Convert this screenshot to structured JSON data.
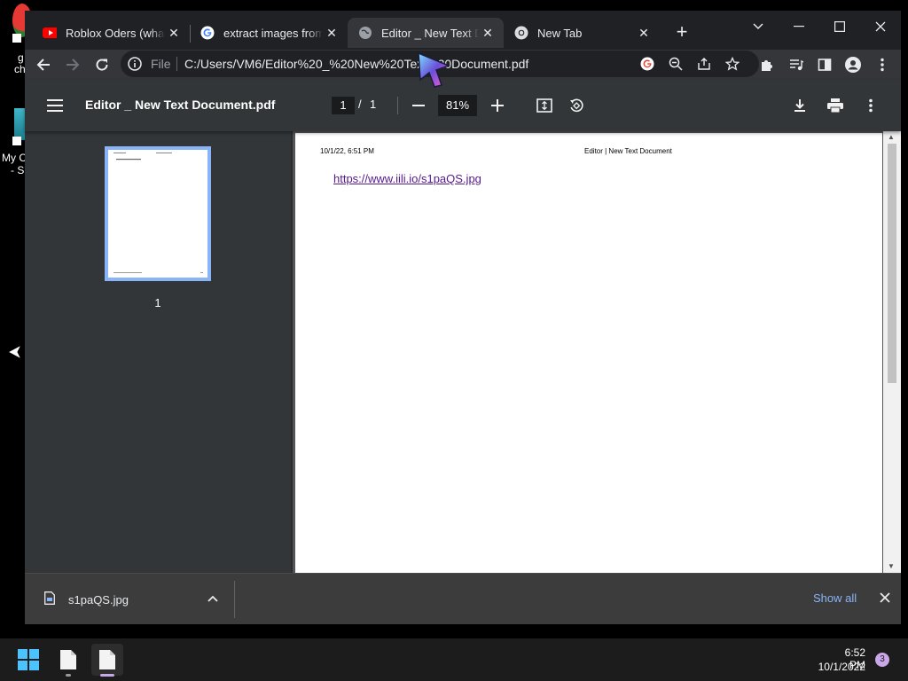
{
  "desktop": {
    "icon1_label_lines": [
      "g",
      "ch"
    ],
    "icon2_label_lines": [
      "My C",
      "- Sl"
    ]
  },
  "tabs": [
    {
      "title": "Roblox Oders (what h",
      "favicon": "youtube-icon",
      "active": false
    },
    {
      "title": "extract images from u",
      "favicon": "google-icon",
      "active": false
    },
    {
      "title": "Editor _ New Text Doc",
      "favicon": "globe-icon",
      "active": true
    },
    {
      "title": "New Tab",
      "favicon": "chrome-icon",
      "active": false
    }
  ],
  "toolbar": {
    "scheme_label": "File",
    "url": "C:/Users/VM6/Editor%20_%20New%20Text%20Document.pdf"
  },
  "pdf": {
    "title": "Editor _ New Text Document.pdf",
    "current_page": "1",
    "page_separator": "/",
    "total_pages": "1",
    "zoom": "81%",
    "thumbnail_label": "1",
    "page": {
      "date": "10/1/22, 6:51 PM",
      "header": "Editor | New Text Document",
      "link": "https://www.iili.io/s1paQS.jpg"
    }
  },
  "download": {
    "filename": "s1paQS.jpg",
    "show_all": "Show all"
  },
  "taskbar": {
    "time": "6:52 PM",
    "date": "10/1/2022",
    "notification_count": "3"
  },
  "colors": {
    "accent": "#8ab4f8",
    "link": "#551a8b",
    "tabstrip": "#202124",
    "toolbar": "#35363a",
    "pdfbar": "#323639",
    "viewer_bg": "#525659",
    "download_bar": "#3c3c3c"
  }
}
